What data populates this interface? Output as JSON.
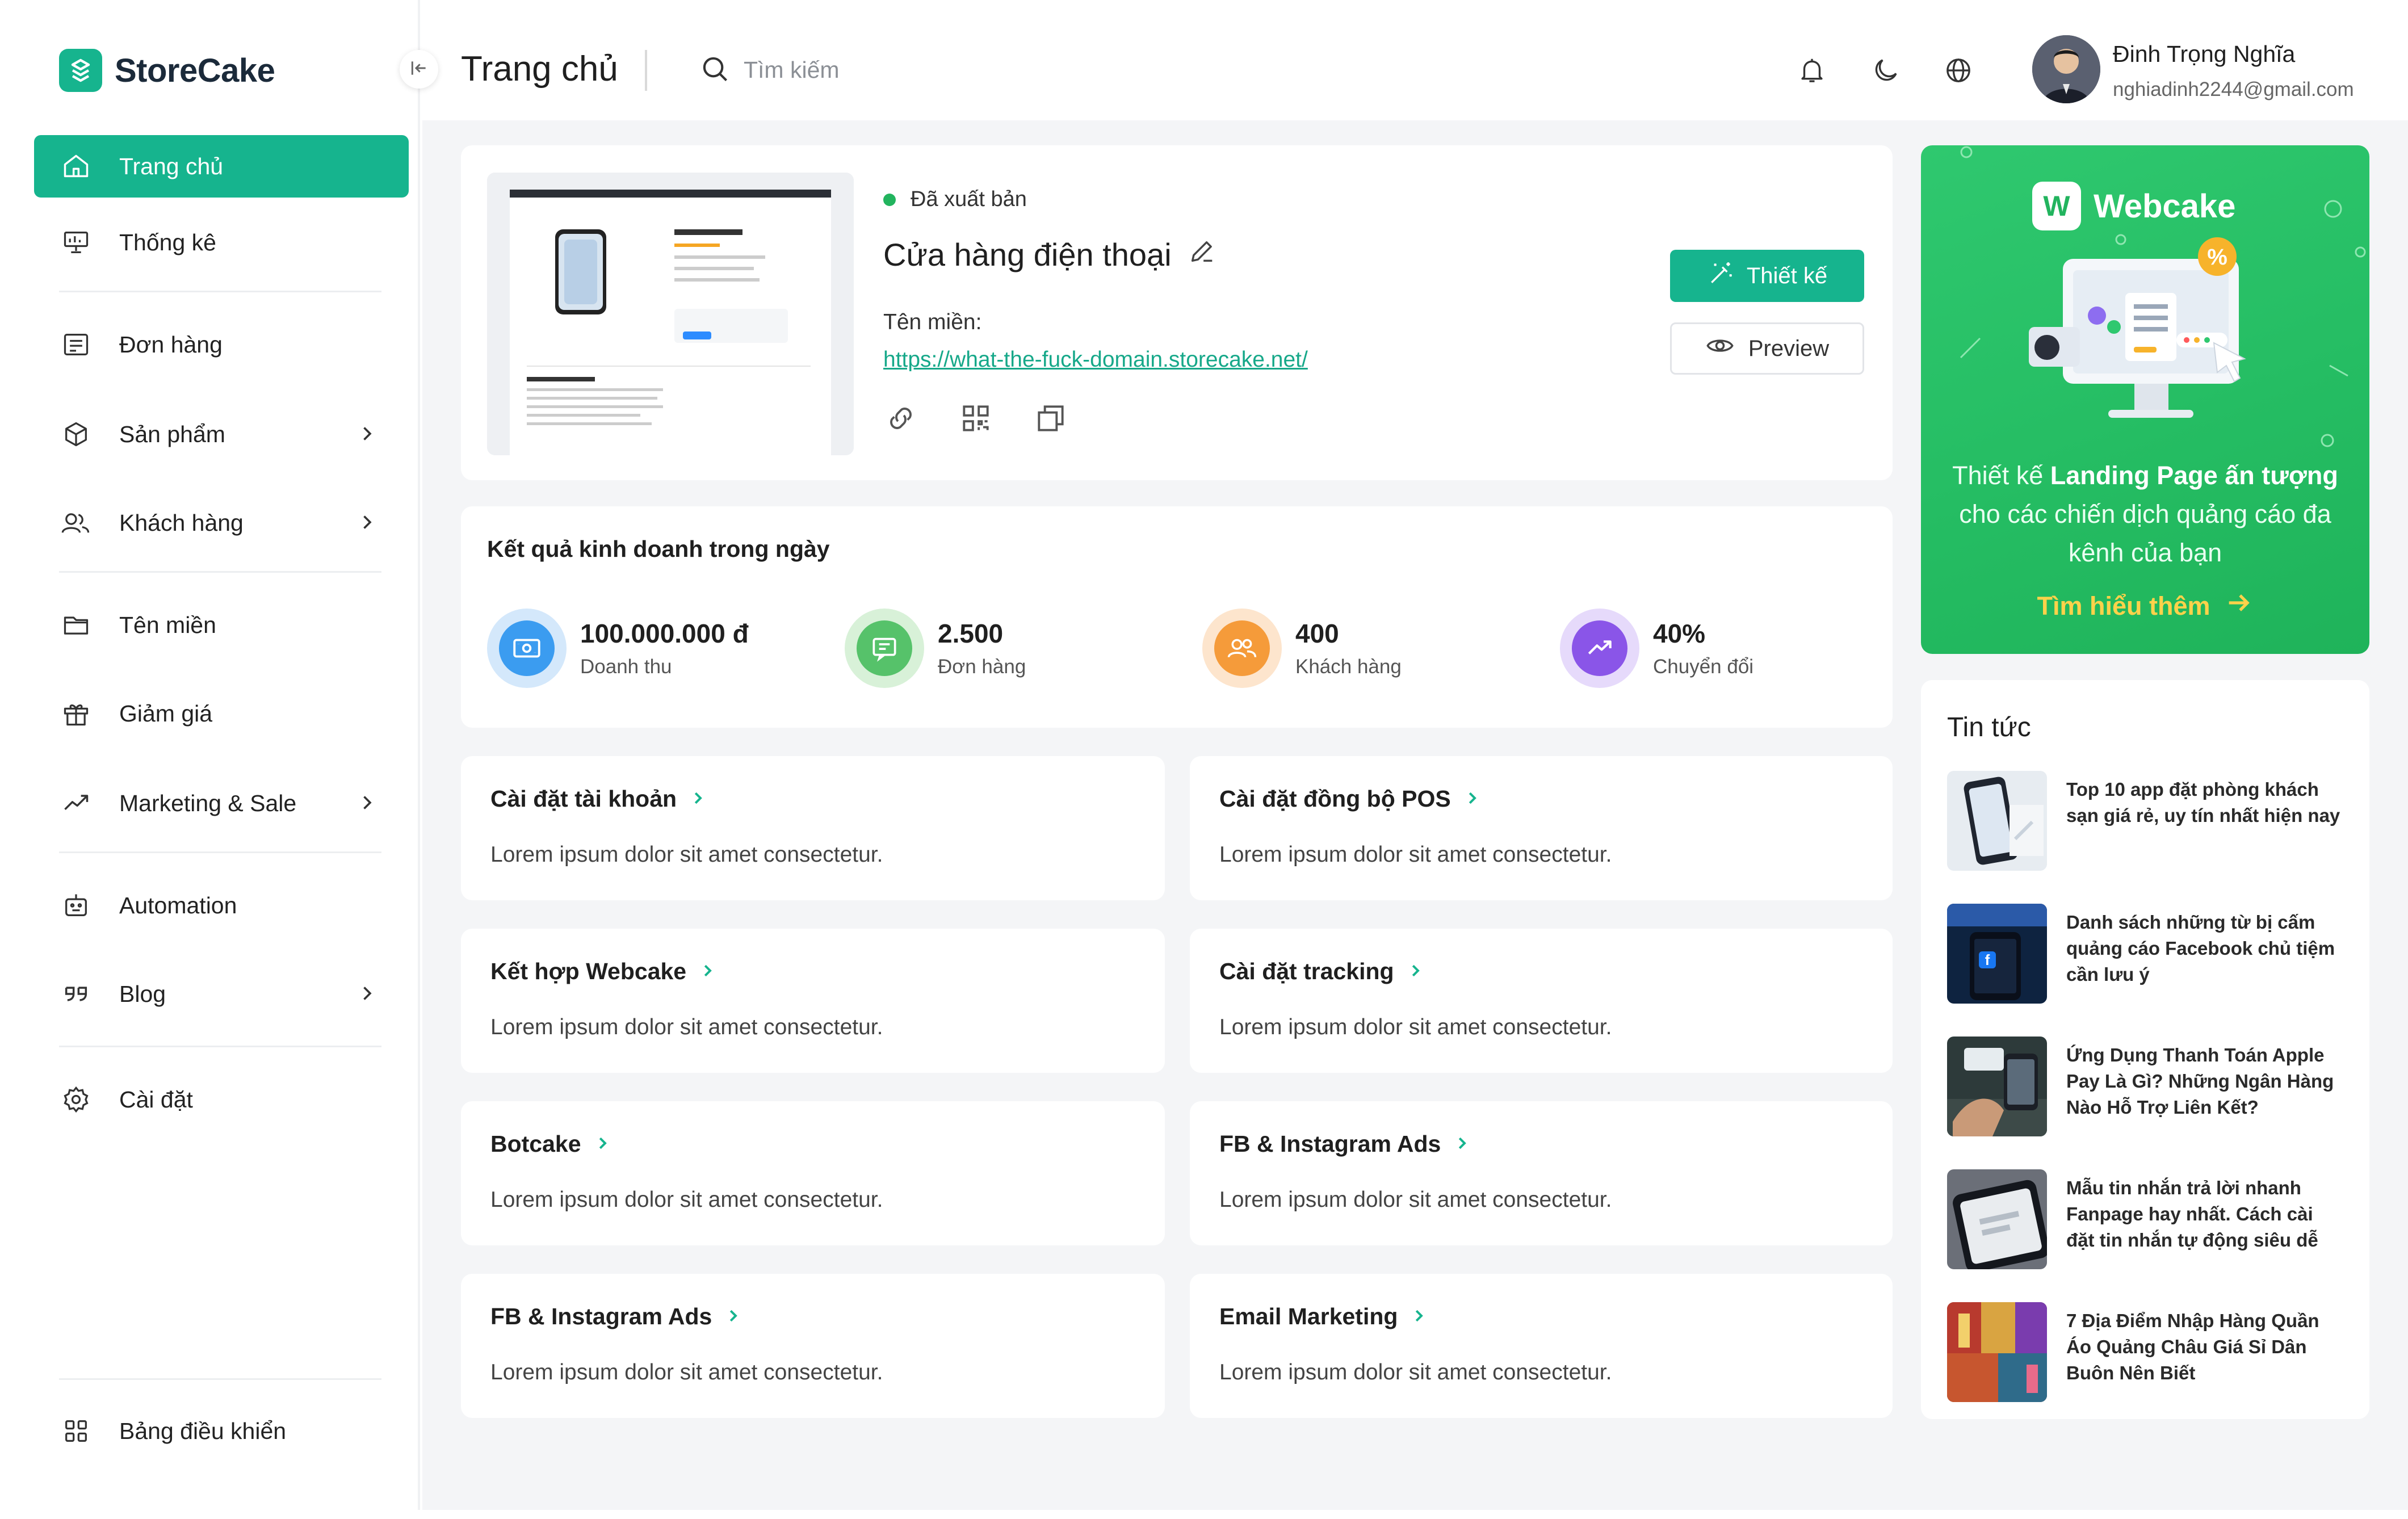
{
  "app": {
    "brand": "StoreCake",
    "page_title": "Trang chủ"
  },
  "search": {
    "placeholder": "Tìm kiếm"
  },
  "user": {
    "name": "Đinh Trọng Nghĩa",
    "email": "nghiadinh2244@gmail.com"
  },
  "sidebar": {
    "items": [
      {
        "label": "Trang chủ",
        "icon": "home-icon",
        "active": true
      },
      {
        "label": "Thống kê",
        "icon": "chart-icon"
      },
      {
        "label": "Đơn hàng",
        "icon": "order-icon"
      },
      {
        "label": "Sản phẩm",
        "icon": "box-icon",
        "has_children": true
      },
      {
        "label": "Khách hàng",
        "icon": "users-icon",
        "has_children": true
      },
      {
        "label": "Tên miền",
        "icon": "folder-icon"
      },
      {
        "label": "Giảm giá",
        "icon": "gift-icon"
      },
      {
        "label": "Marketing & Sale",
        "icon": "trend-icon",
        "has_children": true
      },
      {
        "label": "Automation",
        "icon": "robot-icon"
      },
      {
        "label": "Blog",
        "icon": "quote-icon",
        "has_children": true
      },
      {
        "label": "Cài đặt",
        "icon": "gear-icon"
      }
    ],
    "bottom_item": {
      "label": "Bảng điều khiển",
      "icon": "grid-icon"
    }
  },
  "store": {
    "status": "Đã xuất bản",
    "name": "Cửa hàng điện thoại",
    "domain_label": "Tên miền:",
    "domain_url": "https://what-the-fuck-domain.storecake.net/",
    "design_button": "Thiết kế",
    "preview_button": "Preview"
  },
  "business": {
    "title": "Kết quả kinh doanh trong ngày",
    "metrics": [
      {
        "value": "100.000.000 đ",
        "label": "Doanh thu",
        "color": "#3b9cf0"
      },
      {
        "value": "2.500",
        "label": "Đơn hàng",
        "color": "#56c26a"
      },
      {
        "value": "400",
        "label": "Khách hàng",
        "color": "#f59b3a"
      },
      {
        "value": "40%",
        "label": "Chuyển đổi",
        "color": "#8a55e8"
      }
    ]
  },
  "settings": [
    {
      "title": "Cài đặt tài khoản",
      "desc": "Lorem ipsum dolor sit amet consectetur."
    },
    {
      "title": "Cài đặt đồng bộ POS",
      "desc": "Lorem ipsum dolor sit amet consectetur."
    },
    {
      "title": "Kết hợp Webcake",
      "desc": "Lorem ipsum dolor sit amet consectetur."
    },
    {
      "title": "Cài đặt tracking",
      "desc": "Lorem ipsum dolor sit amet consectetur."
    },
    {
      "title": "Botcake",
      "desc": "Lorem ipsum dolor sit amet consectetur."
    },
    {
      "title": "FB & Instagram Ads",
      "desc": "Lorem ipsum dolor sit amet consectetur."
    },
    {
      "title": "FB & Instagram Ads",
      "desc": "Lorem ipsum dolor sit amet consectetur."
    },
    {
      "title": "Email Marketing",
      "desc": "Lorem ipsum dolor sit amet consectetur."
    }
  ],
  "promo": {
    "brand": "Webcake",
    "text_prefix": "Thiết kế ",
    "text_bold": "Landing Page ấn tượng",
    "text_suffix": " cho các chiến dịch quảng cáo đa kênh của bạn",
    "cta": "Tìm hiểu thêm"
  },
  "news": {
    "title": "Tin tức",
    "items": [
      {
        "title": "Top 10 app đặt phòng khách sạn giá rẻ, uy tín nhất hiện nay"
      },
      {
        "title": "Danh sách những từ bị cấm quảng cáo Facebook  chủ tiệm cần lưu ý"
      },
      {
        "title": "Ứng Dụng Thanh Toán Apple Pay Là Gì? Những Ngân Hàng Nào Hỗ Trợ Liên Kết?"
      },
      {
        "title": "Mẫu tin nhắn trả lời nhanh Fanpage hay nhất. Cách cài đặt tin nhắn tự động siêu dễ"
      },
      {
        "title": "7 Địa Điểm Nhập Hàng Quần Áo Quảng Châu Giá Sỉ Dân Buôn Nên Biết"
      }
    ]
  },
  "colors": {
    "brand": "#16b48e",
    "link": "#16a889",
    "promo_green": "#25bd63",
    "cta_yellow": "#ffd24a"
  }
}
